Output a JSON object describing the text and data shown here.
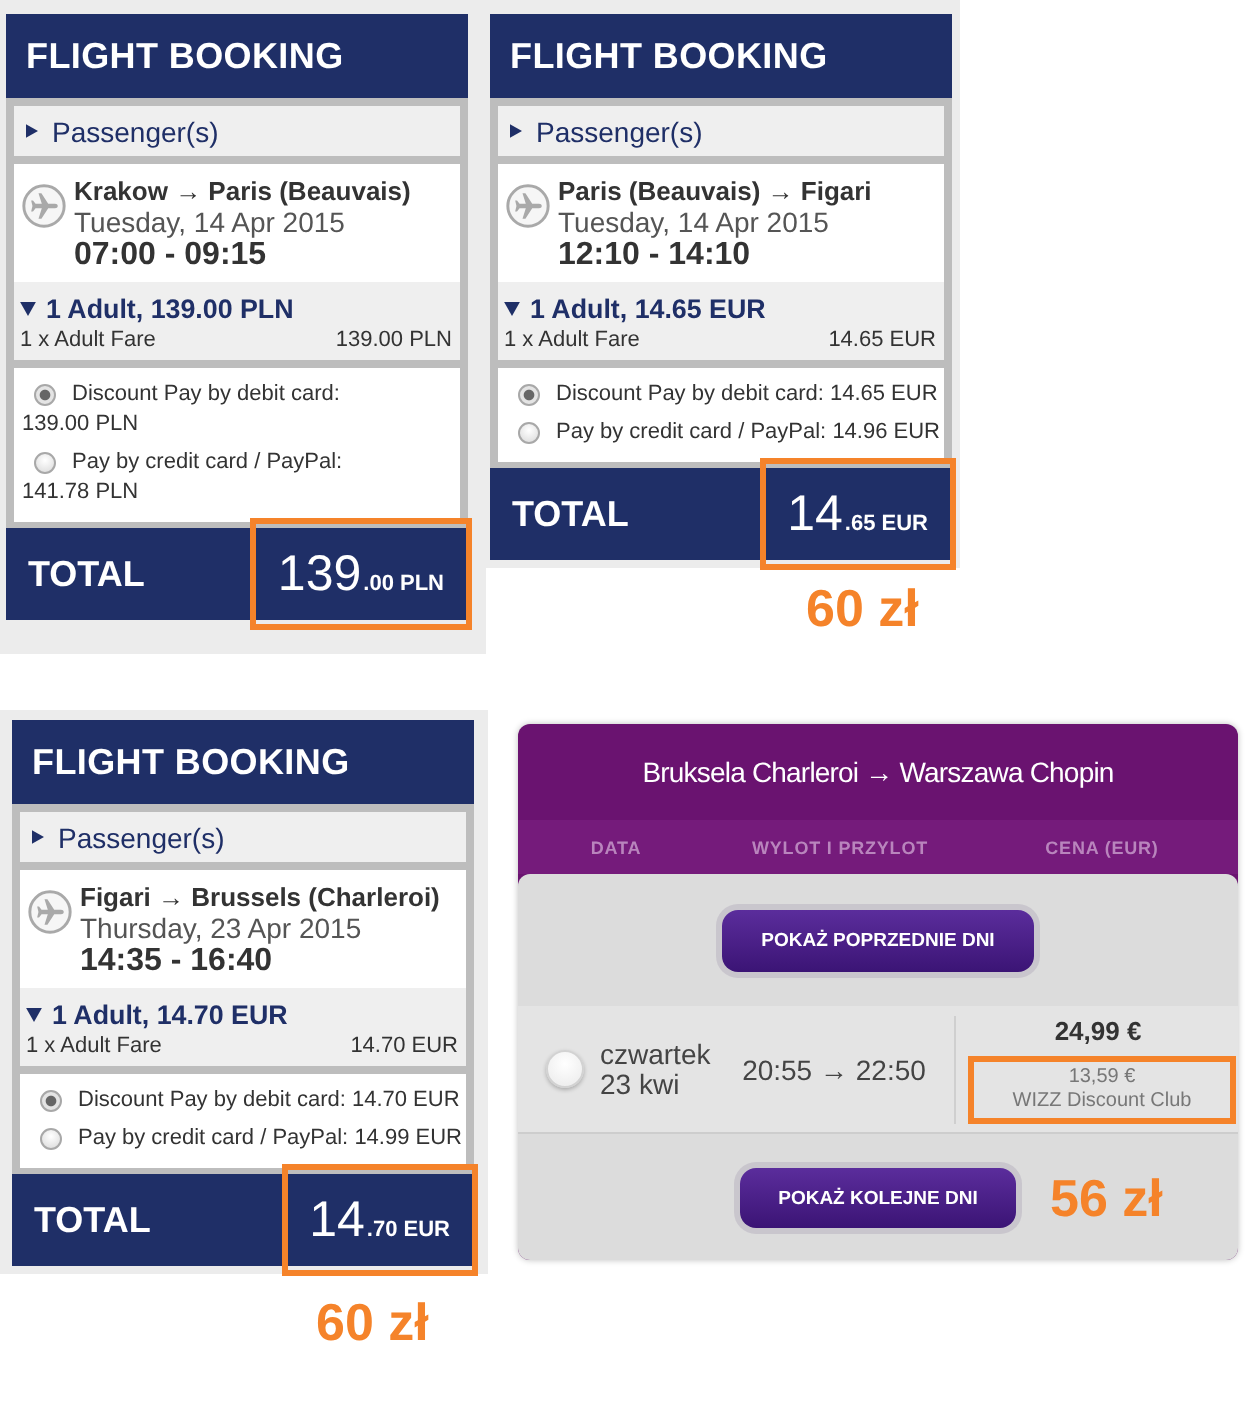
{
  "bookings": [
    {
      "title": "FLIGHT BOOKING",
      "passengers": {
        "label": "Passenger(s)",
        "expanded": false
      },
      "flight": {
        "route": "Krakow → Paris (Beauvais)",
        "date": "Tuesday, 14 Apr 2015",
        "times": "07:00 - 09:15"
      },
      "fare": {
        "summary": "1 Adult, 139.00 PLN",
        "expanded": true,
        "line_label": "1 x Adult Fare",
        "line_amount": "139.00 PLN"
      },
      "payment_wrapped": true,
      "payment_options": [
        {
          "label": "Discount Pay by debit card:",
          "amount": "139.00 PLN",
          "selected": true
        },
        {
          "label": "Pay by credit card / PayPal:",
          "amount": "141.78 PLN",
          "selected": false
        }
      ],
      "total": {
        "label": "TOTAL",
        "amount": "139",
        "fraction": ".00 PLN",
        "highlighted": true
      }
    },
    {
      "title": "FLIGHT BOOKING",
      "passengers": {
        "label": "Passenger(s)",
        "expanded": false
      },
      "flight": {
        "route": "Paris (Beauvais) → Figari",
        "date": "Tuesday, 14 Apr 2015",
        "times": "12:10 - 14:10"
      },
      "fare": {
        "summary": "1 Adult, 14.65 EUR",
        "expanded": true,
        "line_label": "1 x Adult Fare",
        "line_amount": "14.65 EUR"
      },
      "payment_wrapped": false,
      "payment_options": [
        {
          "label": "Discount Pay by debit card:",
          "amount": "14.65 EUR",
          "selected": true
        },
        {
          "label": "Pay by credit card / PayPal:",
          "amount": "14.96 EUR",
          "selected": false
        }
      ],
      "total": {
        "label": "TOTAL",
        "amount": "14",
        "fraction": ".65 EUR",
        "highlighted": true
      },
      "annotation": "60 zł"
    },
    {
      "title": "FLIGHT BOOKING",
      "passengers": {
        "label": "Passenger(s)",
        "expanded": false
      },
      "flight": {
        "route": "Figari → Brussels (Charleroi)",
        "date": "Thursday, 23 Apr 2015",
        "times": "14:35 - 16:40"
      },
      "fare": {
        "summary": "1 Adult, 14.70 EUR",
        "expanded": true,
        "line_label": "1 x Adult Fare",
        "line_amount": "14.70 EUR"
      },
      "payment_wrapped": false,
      "payment_options": [
        {
          "label": "Discount Pay by debit card:",
          "amount": "14.70 EUR",
          "selected": true
        },
        {
          "label": "Pay by credit card / PayPal:",
          "amount": "14.99 EUR",
          "selected": false
        }
      ],
      "total": {
        "label": "TOTAL",
        "amount": "14",
        "fraction": ".70 EUR",
        "highlighted": true
      },
      "annotation": "60 zł"
    }
  ],
  "flight_search": {
    "route": "Bruksela Charleroi → Warszawa Chopin",
    "columns": [
      "DATA",
      "WYLOT I PRZYLOT",
      "CENA (EUR)"
    ],
    "previous_button": "POKAŻ POPRZEDNIE DNI",
    "flights": [
      {
        "selected": false,
        "day": "czwartek",
        "date": "23 kwi",
        "times": "20:55 → 22:50",
        "price": "24,99 €",
        "club_price": "13,59 €",
        "club_label": "WIZZ Discount Club",
        "club_highlighted": true
      }
    ],
    "next_button": "POKAŻ KOLEJNE DNI",
    "annotation": "56 zł"
  }
}
